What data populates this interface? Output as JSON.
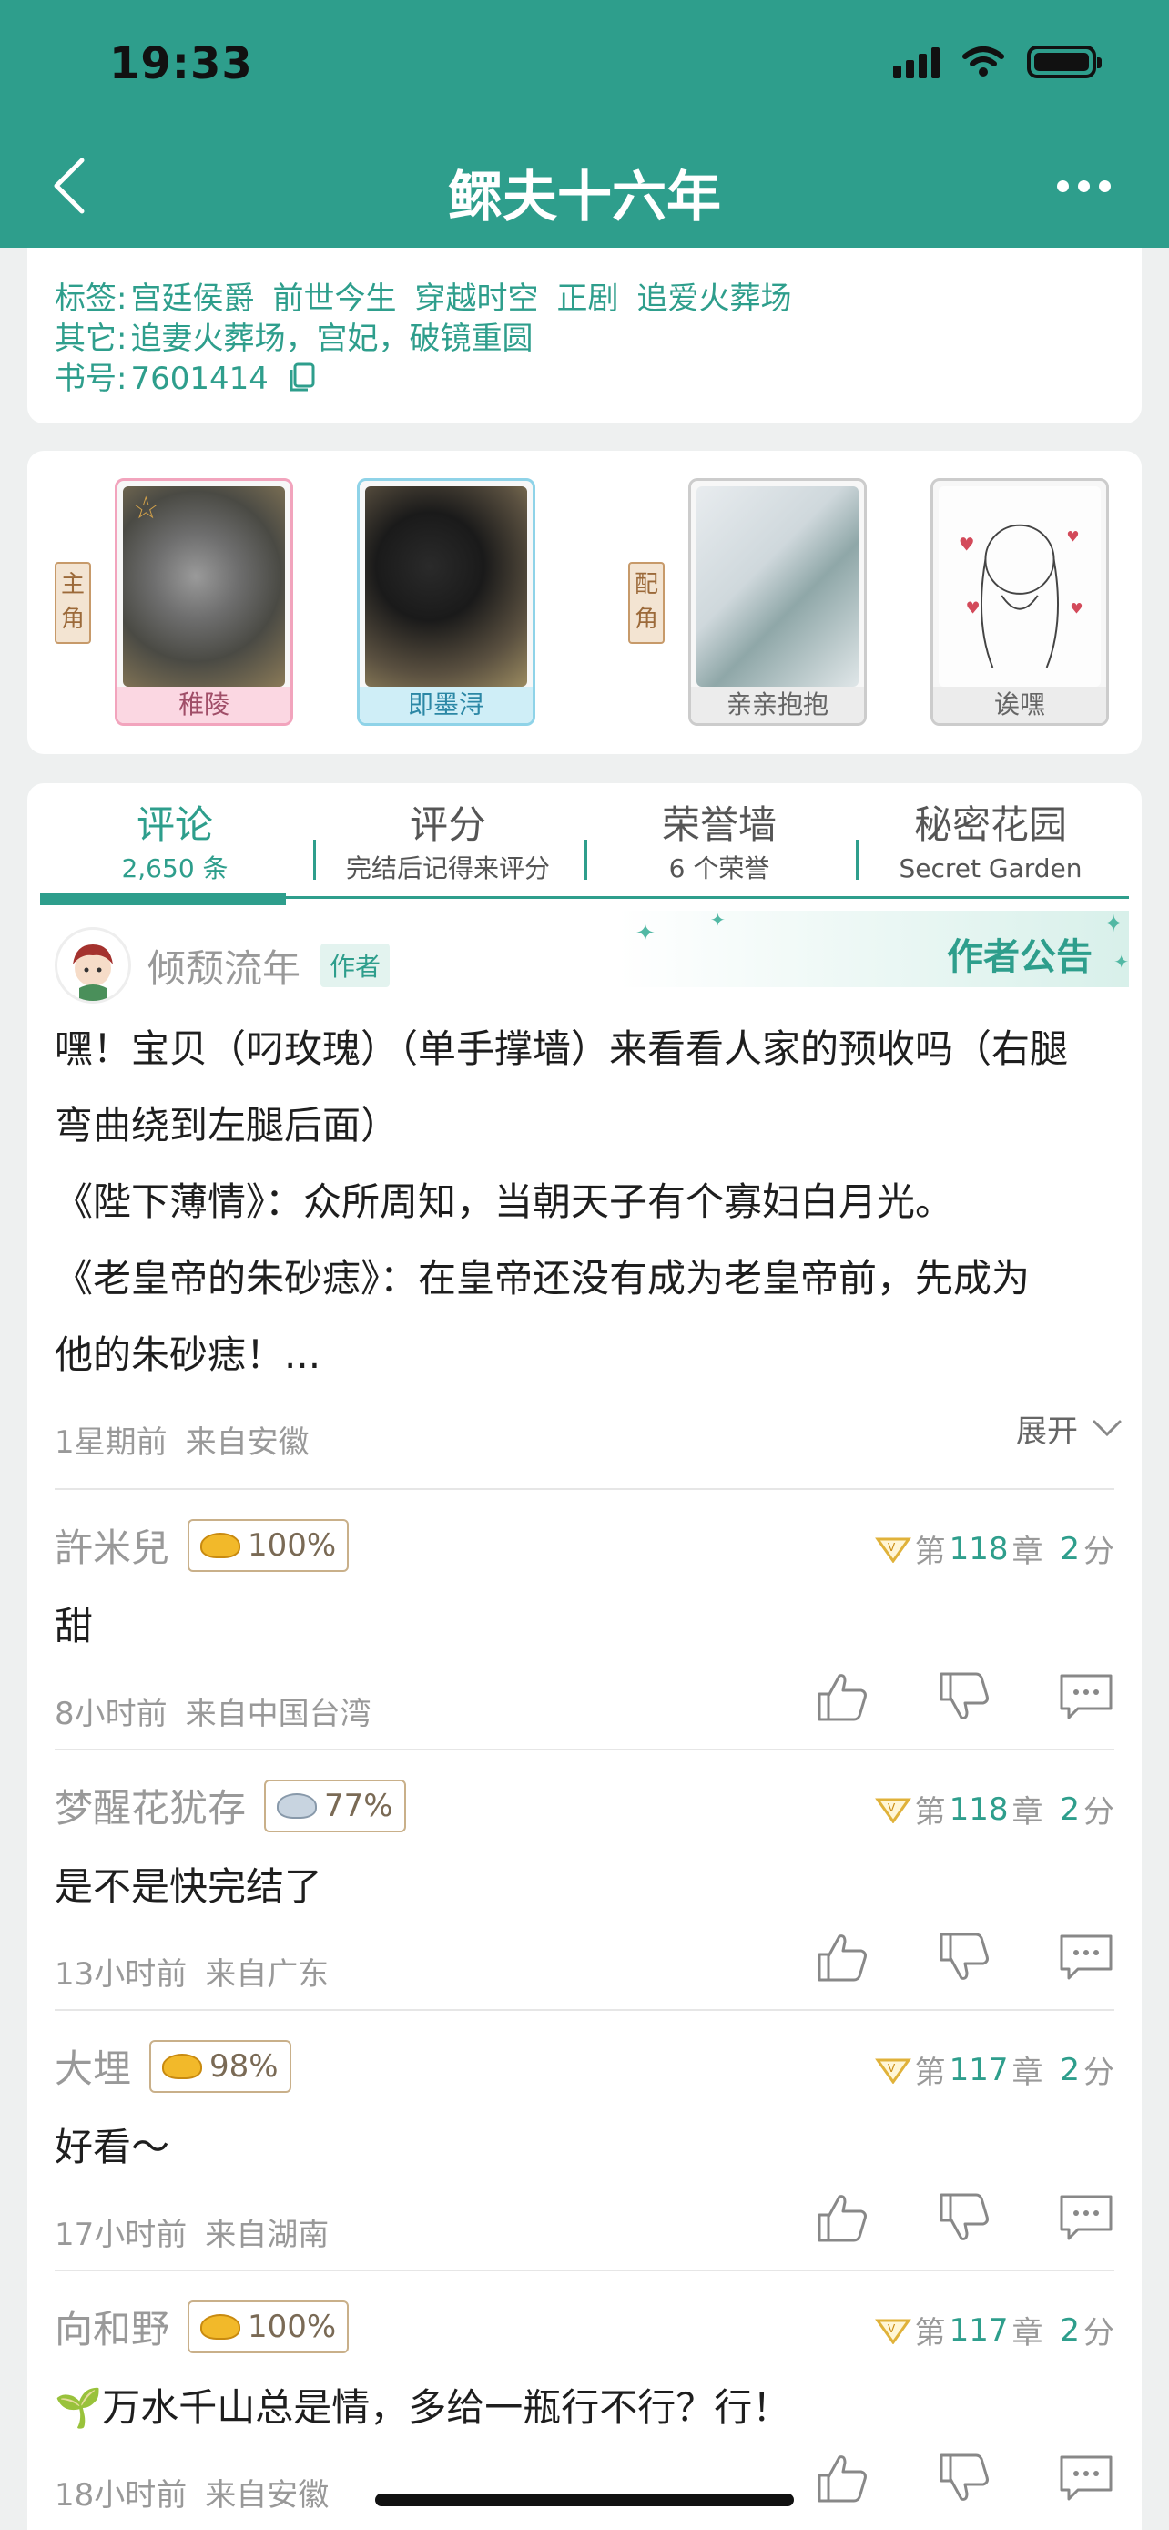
{
  "status_bar": {
    "time": "19:33"
  },
  "nav": {
    "title": "鳏夫十六年"
  },
  "book_info": {
    "tags_label": "标签:",
    "tags": [
      "宫廷侯爵",
      "前世今生",
      "穿越时空",
      "正剧",
      "追爱火葬场"
    ],
    "other_label": "其它:",
    "other": "追妻火葬场，宫妃，破镜重圆",
    "id_label": "书号:",
    "id": "7601414"
  },
  "roles": {
    "main_label": "主角",
    "supporting_label": "配角",
    "characters": [
      {
        "name": "稚陵"
      },
      {
        "name": "即墨浔"
      },
      {
        "name": "亲亲抱抱"
      },
      {
        "name": "诶嘿"
      }
    ]
  },
  "tabs": [
    {
      "label": "评论",
      "sub": "2,650 条"
    },
    {
      "label": "评分",
      "sub": "完结后记得来评分"
    },
    {
      "label": "荣誉墙",
      "sub": "6 个荣誉"
    },
    {
      "label": "秘密花园",
      "sub": "Secret Garden"
    }
  ],
  "notice": {
    "banner": "作者公告",
    "author": "倾颓流年",
    "author_badge": "作者",
    "lines": [
      "嘿！宝贝（叼玫瑰）（单手撑墙）来看看人家的预收吗（右腿",
      "弯曲绕到左腿后面）",
      "《陛下薄情》：众所周知，当朝天子有个寡妇白月光。",
      "《老皇帝的朱砂痣》：在皇帝还没有成为老皇帝前，先成为",
      "他的朱砂痣！..."
    ],
    "time": "1星期前",
    "location": "来自安徽",
    "expand": "展开"
  },
  "comments": [
    {
      "user": "許米兒",
      "badge": "100%",
      "chapter_prefix": "第",
      "chapter": "118",
      "chapter_suffix": "章",
      "score": "2",
      "score_suffix": "分",
      "text": "甜",
      "time": "8小时前",
      "location": "来自中国台湾"
    },
    {
      "user": "梦醒花犹存",
      "badge": "77%",
      "chapter_prefix": "第",
      "chapter": "118",
      "chapter_suffix": "章",
      "score": "2",
      "score_suffix": "分",
      "text": "是不是快完结了",
      "time": "13小时前",
      "location": "来自广东"
    },
    {
      "user": "大埋",
      "badge": "98%",
      "chapter_prefix": "第",
      "chapter": "117",
      "chapter_suffix": "章",
      "score": "2",
      "score_suffix": "分",
      "text": "好看～",
      "time": "17小时前",
      "location": "来自湖南"
    },
    {
      "user": "向和野",
      "badge": "100%",
      "chapter_prefix": "第",
      "chapter": "117",
      "chapter_suffix": "章",
      "score": "2",
      "score_suffix": "分",
      "text": "万水千山总是情，多给一瓶行不行？行！",
      "time": "18小时前",
      "location": "来自安徽"
    }
  ],
  "colors": {
    "accent": "#2e9e8c",
    "background": "#eef0f0"
  }
}
